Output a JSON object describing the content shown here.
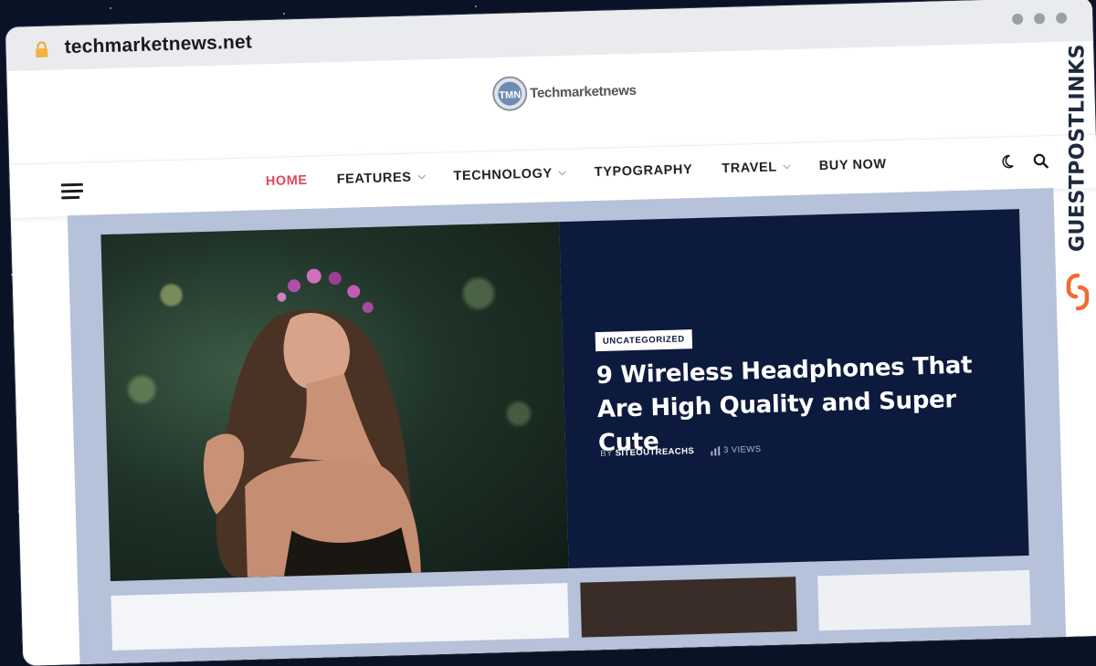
{
  "browser": {
    "url": "techmarketnews.net"
  },
  "site": {
    "logo_text": "Techmarketnews",
    "logo_mark": "TMN"
  },
  "nav": {
    "items": [
      {
        "label": "HOME",
        "active": true,
        "has_dropdown": false
      },
      {
        "label": "FEATURES",
        "active": false,
        "has_dropdown": true
      },
      {
        "label": "TECHNOLOGY",
        "active": false,
        "has_dropdown": true
      },
      {
        "label": "TYPOGRAPHY",
        "active": false,
        "has_dropdown": false
      },
      {
        "label": "TRAVEL",
        "active": false,
        "has_dropdown": true
      },
      {
        "label": "BUY NOW",
        "active": false,
        "has_dropdown": false
      }
    ],
    "tools": [
      "dark-mode-icon",
      "search-icon"
    ]
  },
  "hero": {
    "category": "UNCATEGORIZED",
    "title": "9 Wireless Headphones That Are High Quality and Super Cute",
    "author_prefix": "BY",
    "author": "SITEOUTREACHS",
    "views": "3 VIEWS"
  },
  "watermark": {
    "text": "GUESTPOSTLINKS"
  },
  "colors": {
    "accent": "#e0475f",
    "panel": "#0c1a3d",
    "band": "#b6c2d9",
    "brand_orange": "#f26a2e"
  }
}
